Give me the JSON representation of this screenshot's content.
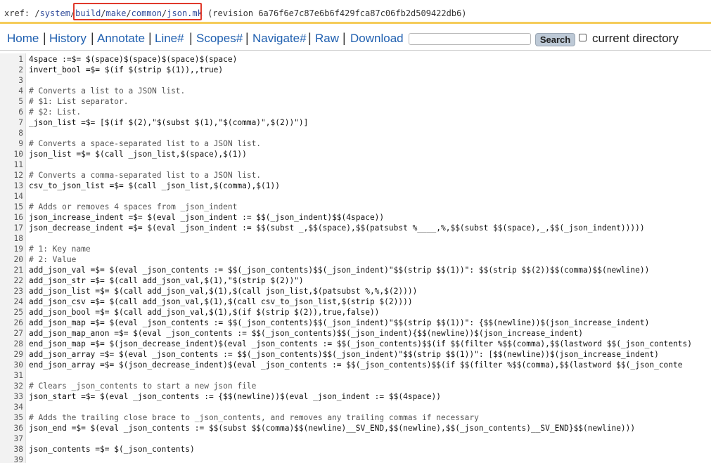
{
  "xref": {
    "prefix": "xref: /",
    "path_parts": [
      "system",
      "build",
      "make",
      "common",
      "json.mk"
    ],
    "revision_text": " (revision 6a76f6e7c87e6b6f429fca87c06fb2d509422db6)"
  },
  "nav": {
    "items": [
      "Home",
      "History",
      "Annotate",
      "Line#",
      "Scopes#",
      "Navigate#",
      "Raw",
      "Download"
    ],
    "search_button": "Search",
    "checkbox_label": "current directory"
  },
  "code": {
    "lines": [
      {
        "n": "1",
        "t": "4space :=$= $(space)$(space)$(space)$(space)"
      },
      {
        "n": "2",
        "t": "invert_bool =$= $(if $(strip $(1)),,true)"
      },
      {
        "n": "3",
        "t": ""
      },
      {
        "n": "4",
        "t": "# Converts a list to a JSON list."
      },
      {
        "n": "5",
        "t": "# $1: List separator."
      },
      {
        "n": "6",
        "t": "# $2: List."
      },
      {
        "n": "7",
        "t": "_json_list =$= [$(if $(2),\"$(subst $(1),\"$(comma)\",$(2))\")]"
      },
      {
        "n": "8",
        "t": ""
      },
      {
        "n": "9",
        "t": "# Converts a space-separated list to a JSON list."
      },
      {
        "n": "10",
        "t": "json_list =$= $(call _json_list,$(space),$(1))"
      },
      {
        "n": "11",
        "t": ""
      },
      {
        "n": "12",
        "t": "# Converts a comma-separated list to a JSON list."
      },
      {
        "n": "13",
        "t": "csv_to_json_list =$= $(call _json_list,$(comma),$(1))"
      },
      {
        "n": "14",
        "t": ""
      },
      {
        "n": "15",
        "t": "# Adds or removes 4 spaces from _json_indent"
      },
      {
        "n": "16",
        "t": "json_increase_indent =$= $(eval _json_indent := $$(_json_indent)$$(4space))"
      },
      {
        "n": "17",
        "t": "json_decrease_indent =$= $(eval _json_indent := $$(subst _,$$(space),$$(patsubst %____,%,$$(subst $$(space),_,$$(_json_indent)))))"
      },
      {
        "n": "18",
        "t": ""
      },
      {
        "n": "19",
        "t": "# 1: Key name"
      },
      {
        "n": "20",
        "t": "# 2: Value"
      },
      {
        "n": "21",
        "t": "add_json_val =$= $(eval _json_contents := $$(_json_contents)$$(_json_indent)\"$$(strip $$(1))\": $$(strip $$(2))$$(comma)$$(newline))"
      },
      {
        "n": "22",
        "t": "add_json_str =$= $(call add_json_val,$(1),\"$(strip $(2))\")"
      },
      {
        "n": "23",
        "t": "add_json_list =$= $(call add_json_val,$(1),$(call json_list,$(patsubst %,%,$(2))))"
      },
      {
        "n": "24",
        "t": "add_json_csv =$= $(call add_json_val,$(1),$(call csv_to_json_list,$(strip $(2))))"
      },
      {
        "n": "25",
        "t": "add_json_bool =$= $(call add_json_val,$(1),$(if $(strip $(2)),true,false))"
      },
      {
        "n": "26",
        "t": "add_json_map =$= $(eval _json_contents := $$(_json_contents)$$(_json_indent)\"$$(strip $$(1))\": {$$(newline))$(json_increase_indent)"
      },
      {
        "n": "27",
        "t": "add_json_map_anon =$= $(eval _json_contents := $$(_json_contents)$$(_json_indent){$$(newline))$(json_increase_indent)"
      },
      {
        "n": "28",
        "t": "end_json_map =$= $(json_decrease_indent)$(eval _json_contents := $$(_json_contents)$$(if $$(filter %$$(comma),$$(lastword $$(_json_contents)"
      },
      {
        "n": "29",
        "t": "add_json_array =$= $(eval _json_contents := $$(_json_contents)$$(_json_indent)\"$$(strip $$(1))\": [$$(newline))$(json_increase_indent)"
      },
      {
        "n": "30",
        "t": "end_json_array =$= $(json_decrease_indent)$(eval _json_contents := $$(_json_contents)$$(if $$(filter %$$(comma),$$(lastword $$(_json_conte"
      },
      {
        "n": "31",
        "t": ""
      },
      {
        "n": "32",
        "t": "# Clears _json_contents to start a new json file"
      },
      {
        "n": "33",
        "t": "json_start =$= $(eval _json_contents := {$$(newline))$(eval _json_indent := $$(4space))"
      },
      {
        "n": "34",
        "t": ""
      },
      {
        "n": "35",
        "t": "# Adds the trailing close brace to _json_contents, and removes any trailing commas if necessary"
      },
      {
        "n": "36",
        "t": "json_end =$= $(eval _json_contents := $$(subst $$(comma)$$(newline)__SV_END,$$(newline),$$(_json_contents)__SV_END}$$(newline)))"
      },
      {
        "n": "37",
        "t": ""
      },
      {
        "n": "38",
        "t": "json_contents =$= $(_json_contents)"
      },
      {
        "n": "39",
        "t": ""
      }
    ]
  }
}
